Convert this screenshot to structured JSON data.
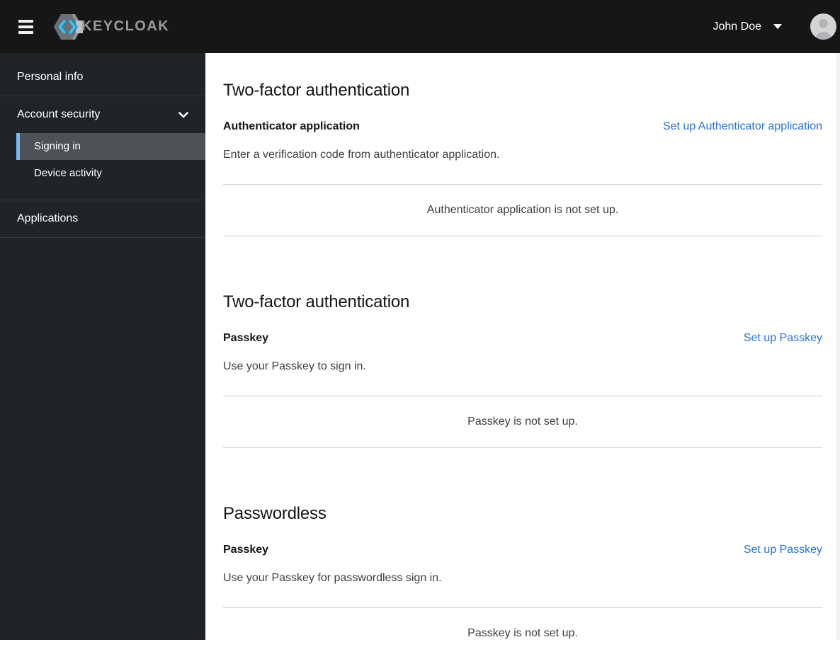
{
  "header": {
    "brand": "KEYCLOAK",
    "user": {
      "name": "John Doe"
    }
  },
  "sidebar": {
    "items": [
      {
        "label": "Personal info"
      },
      {
        "label": "Account security",
        "expanded": true,
        "children": [
          {
            "label": "Signing in",
            "active": true
          },
          {
            "label": "Device activity",
            "active": false
          }
        ]
      },
      {
        "label": "Applications"
      }
    ]
  },
  "main": {
    "sections": [
      {
        "title": "Two-factor authentication",
        "credential": {
          "label": "Authenticator application",
          "action": "Set up Authenticator application",
          "description": "Enter a verification code from authenticator application.",
          "empty_message": "Authenticator application is not set up."
        }
      },
      {
        "title": "Two-factor authentication",
        "credential": {
          "label": "Passkey",
          "action": "Set up Passkey",
          "description": "Use your Passkey to sign in.",
          "empty_message": "Passkey is not set up."
        }
      },
      {
        "title": "Passwordless",
        "credential": {
          "label": "Passkey",
          "action": "Set up Passkey",
          "description": "Use your Passkey for passwordless sign in.",
          "empty_message": "Passkey is not set up."
        }
      }
    ]
  },
  "icons": {
    "nav_toggle": "hamburger-icon",
    "brand": "keycloak-logo-icon",
    "account_security": "chevron-down-icon",
    "user_menu": "caret-down-icon",
    "avatar": "user-avatar-icon"
  },
  "colors": {
    "masthead_bg": "#161616",
    "sidebar_bg": "#212427",
    "active_item_bg": "#4f5255",
    "active_indicator": "#73bcf7",
    "link": "#2a72cc",
    "divider": "#d2d2d2",
    "heading_text": "#151515",
    "body_text": "#3c3f42"
  }
}
